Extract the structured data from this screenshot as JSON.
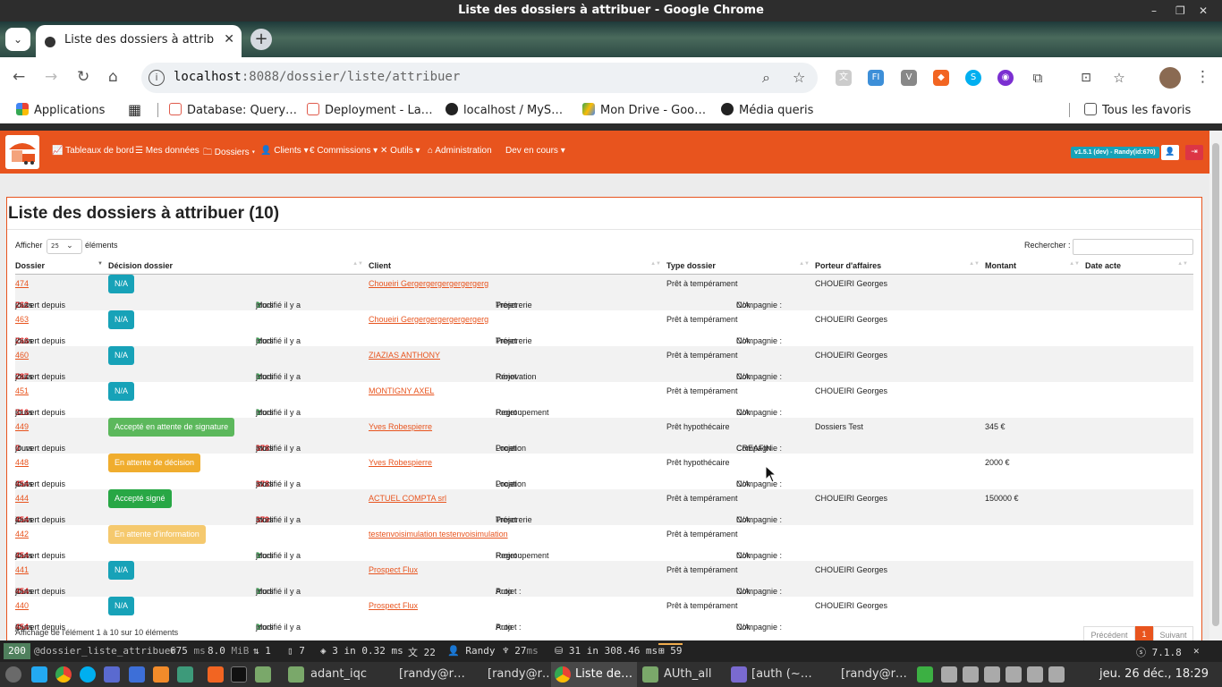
{
  "window": {
    "title": "Liste des dossiers à attribuer - Google Chrome"
  },
  "tab": {
    "title": "Liste des dossiers à attribuer",
    "close": "✕"
  },
  "omnibox": {
    "host": "localhost",
    "rest": ":8088/dossier/liste/attribuer"
  },
  "bookmarks": {
    "apps": "Applications",
    "items": [
      "Database: Query…",
      "Deployment - La…",
      "localhost / MyS…",
      "Mon Drive - Goo…",
      "Média queris"
    ],
    "all": "Tous les favoris"
  },
  "appnav": {
    "items": [
      "Tableaux de bord",
      "Mes données",
      "Dossiers ▾",
      "Clients ▾",
      "Commissions ▾",
      "Outils ▾",
      "Administration",
      "Dev en cours ▾"
    ],
    "version": "v1.5.1 (dev) - Randy(id:670)",
    "accent": "#e8541e"
  },
  "page": {
    "title": "Liste des dossiers à attribuer (10)",
    "show_label": "Afficher",
    "show_value": "25",
    "elements_label": "éléments",
    "search_label": "Rechercher :",
    "columns": [
      "Dossier",
      "Décision dossier",
      "Client",
      "Type dossier",
      "Porteur d'affaires",
      "Montant",
      "Date acte"
    ],
    "info": "Affichage de l'élément 1 à 10 sur 10 éléments",
    "prev": "Précédent",
    "page_num": "1",
    "next": "Suivant"
  },
  "labels": {
    "ouvert": "Ouvert depuis",
    "jours": "jours",
    "modifie": "Modifié il y a",
    "projet": "Projet :",
    "compagnie": "Compagnie :"
  },
  "rows": [
    {
      "id": "474",
      "decision": "N/A",
      "badge": "b-na",
      "client": "Choueiri Gergergergergergergerg",
      "type": "Prêt à tempérament",
      "porteur": "CHOUEIRI Georges",
      "montant": "",
      "date": "",
      "ouvert": "262",
      "modifie": "0",
      "projet": "Trésorerie",
      "compagnie": "N/A"
    },
    {
      "id": "463",
      "decision": "N/A",
      "badge": "b-na",
      "client": "Choueiri Gergergergergergergerg",
      "type": "Prêt à tempérament",
      "porteur": "CHOUEIRI Georges",
      "montant": "",
      "date": "",
      "ouvert": "266",
      "modifie": "0",
      "projet": "Trésorerie",
      "compagnie": "N/A"
    },
    {
      "id": "460",
      "decision": "N/A",
      "badge": "b-na",
      "client": "ZIAZIAS ANTHONY",
      "type": "Prêt à tempérament",
      "porteur": "CHOUEIRI Georges",
      "montant": "",
      "date": "",
      "ouvert": "287",
      "modifie": "0",
      "projet": "Rénovation",
      "compagnie": "N/A"
    },
    {
      "id": "451",
      "decision": "N/A",
      "badge": "b-na",
      "client": "MONTIGNY AXEL",
      "type": "Prêt à tempérament",
      "porteur": "CHOUEIRI Georges",
      "montant": "",
      "date": "",
      "ouvert": "316",
      "modifie": "0",
      "projet": "Regroupement",
      "compagnie": "N/A"
    },
    {
      "id": "449",
      "decision": "Accepté en attente de signature",
      "badge": "b-ok",
      "client": "Yves Robespierre",
      "type": "Prêt hypothécaire",
      "porteur": "Dossiers Test",
      "montant": "345 €",
      "date": "",
      "ouvert": "0",
      "modifie": "378",
      "projet": "Location",
      "compagnie": "CREAFIN"
    },
    {
      "id": "448",
      "decision": "En attente de décision",
      "badge": "b-warn",
      "client": "Yves Robespierre",
      "type": "Prêt hypothécaire",
      "porteur": "",
      "montant": "2000 €",
      "date": "",
      "ouvert": "454",
      "modifie": "378",
      "projet": "Location",
      "compagnie": "N/A"
    },
    {
      "id": "444",
      "decision": "Accepté signé",
      "badge": "b-ok2",
      "client": "ACTUEL COMPTA srl",
      "type": "Prêt à tempérament",
      "porteur": "CHOUEIRI Georges",
      "montant": "150000 €",
      "date": "",
      "ouvert": "454",
      "modifie": "379",
      "projet": "Trésorerie",
      "compagnie": "N/A"
    },
    {
      "id": "442",
      "decision": "En attente d'information",
      "badge": "b-info",
      "client": "testenvoisimulation testenvoisimulation",
      "type": "Prêt à tempérament",
      "porteur": "",
      "montant": "",
      "date": "",
      "ouvert": "454",
      "modifie": "0",
      "projet": "Regroupement",
      "compagnie": "N/A"
    },
    {
      "id": "441",
      "decision": "N/A",
      "badge": "b-na",
      "client": "Prospect Flux",
      "type": "Prêt à tempérament",
      "porteur": "CHOUEIRI Georges",
      "montant": "",
      "date": "",
      "ouvert": "454",
      "modifie": "0",
      "projet": "Auto",
      "compagnie": "N/A"
    },
    {
      "id": "440",
      "decision": "N/A",
      "badge": "b-na",
      "client": "Prospect Flux",
      "type": "Prêt à tempérament",
      "porteur": "CHOUEIRI Georges",
      "montant": "",
      "date": "",
      "ouvert": "454",
      "modifie": "0",
      "projet": "Auto",
      "compagnie": "N/A"
    }
  ],
  "debugbar": {
    "status": "200",
    "route": "@dossier_liste_attribuer",
    "time": "675",
    "time_unit": "ms",
    "memory": "8.0",
    "memory_unit": "MiB",
    "logs": "1",
    "forms": "7",
    "cache": "3 in 0.32 ms",
    "translations": "22",
    "user": "Randy",
    "twig": "27",
    "twig_unit": "ms",
    "db": "31 in 308.46 ms",
    "events": "59",
    "sf_version": "7.1.8"
  },
  "taskbar": {
    "items": [
      "adant_iqc",
      "[randy@r…",
      "[randy@r…",
      "Liste de…",
      "AUth_all",
      "[auth (~…",
      "[randy@r…"
    ],
    "clock": "jeu. 26 déc., 18:29"
  }
}
